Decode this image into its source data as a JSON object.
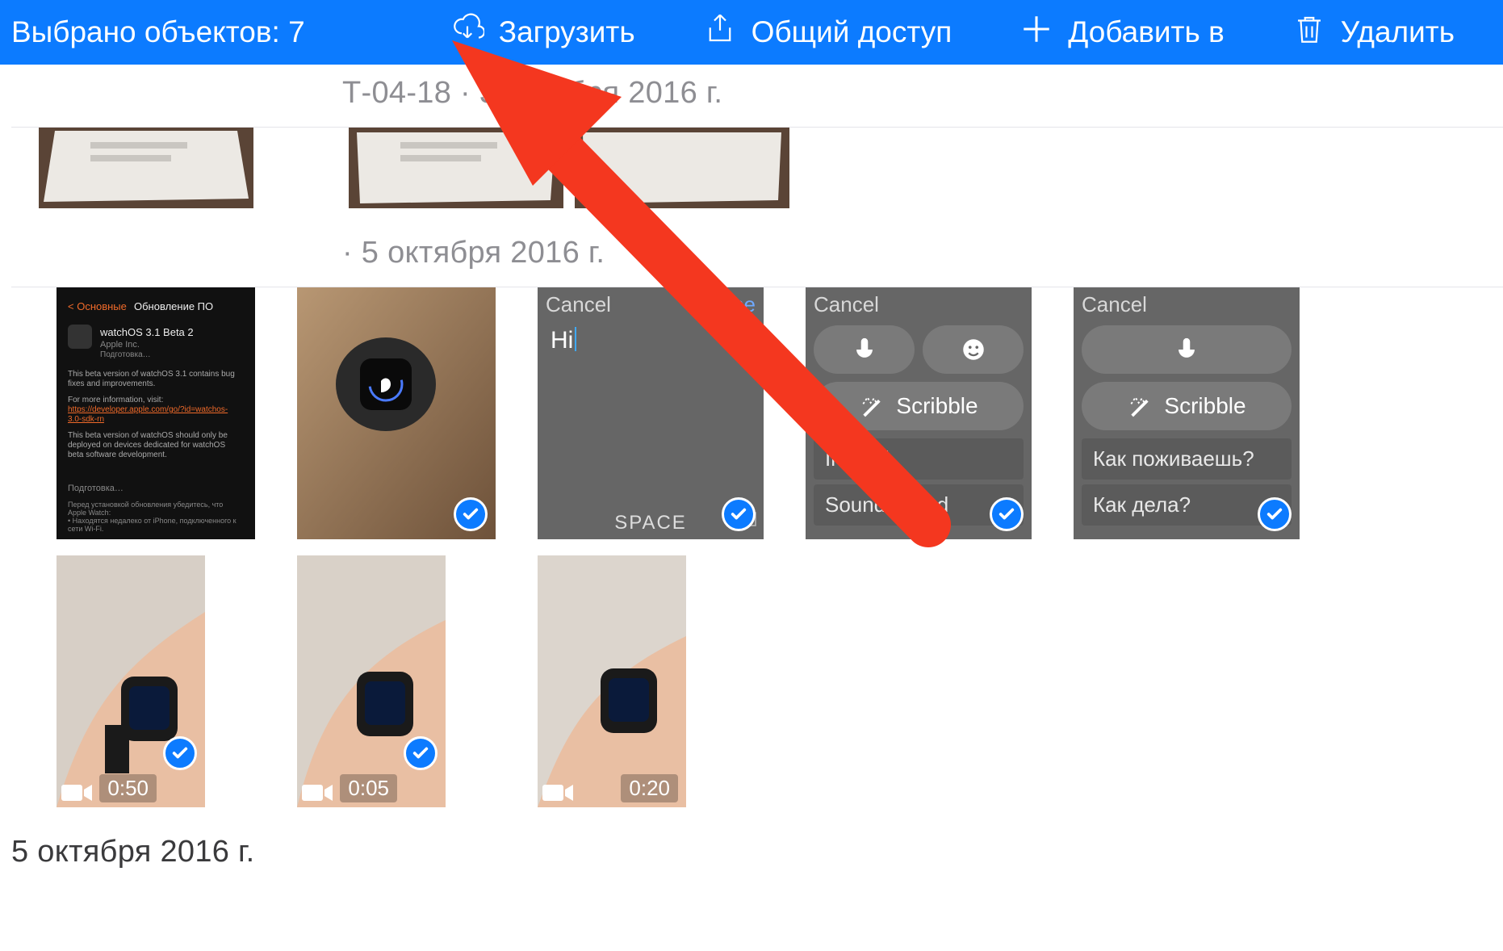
{
  "toolbar": {
    "selection_label": "Выбрано объектов: 7",
    "download_label": "Загрузить",
    "share_label": "Общий доступ",
    "add_label": "Добавить в",
    "delete_label": "Удалить"
  },
  "sections": {
    "s1_head": "Т-04-18 · 3 октября 2016 г.",
    "s2_head": " · 5 октября 2016 г.",
    "bottom_head": "5 октября 2016 г."
  },
  "videos": {
    "v1_dur": "0:50",
    "v2_dur": "0:05",
    "v3_dur": "0:20"
  },
  "watch_ui": {
    "cancel": "Cancel",
    "done": "Done",
    "hi": "Hi",
    "space": "SPACE",
    "scribble": "Scribble",
    "indeed": "Indeed",
    "sounds_good": "Sounds good",
    "ru_how1": "Как поживаешь?",
    "ru_how2": "Как дела?"
  },
  "colors": {
    "accent": "#0c7bff",
    "arrow": "#f4371f"
  }
}
